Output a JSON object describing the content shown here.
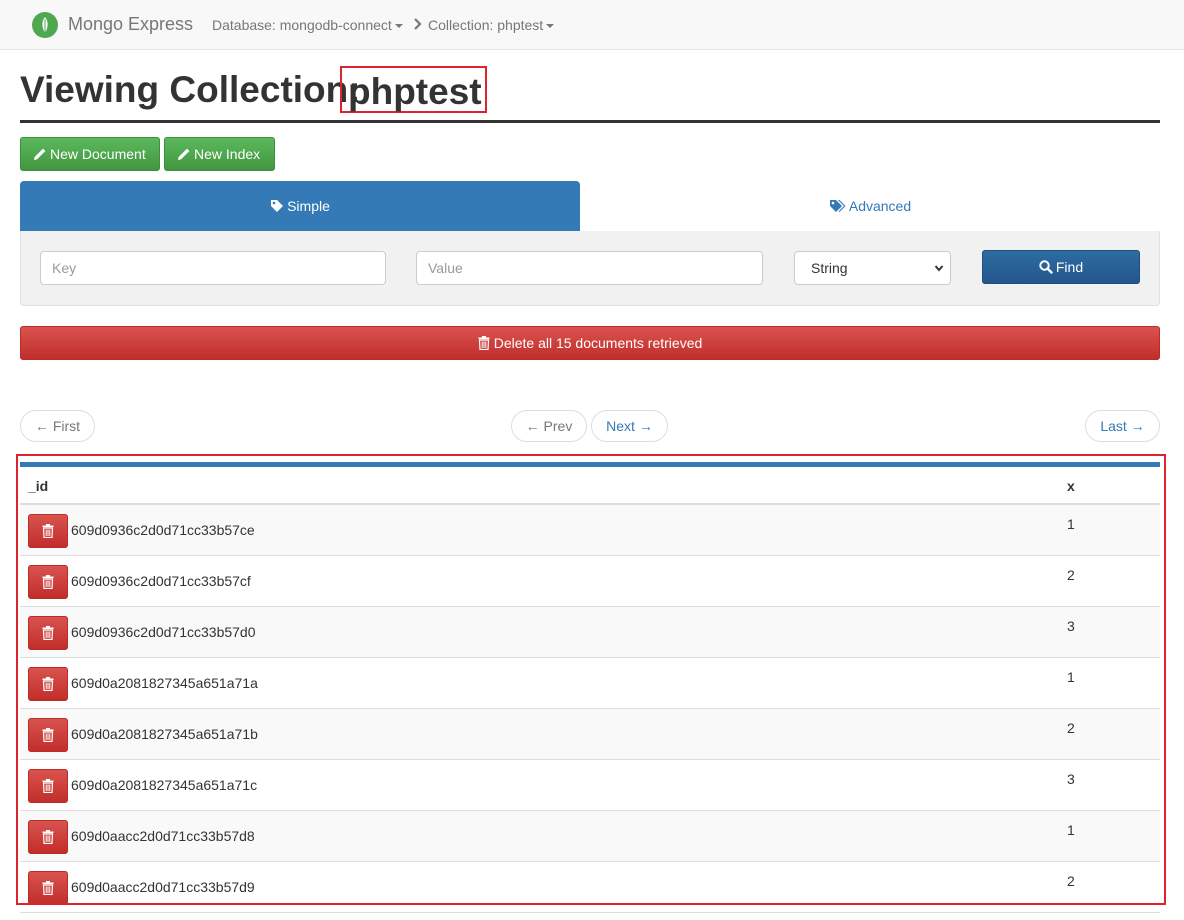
{
  "app": {
    "title": "Mongo Express"
  },
  "breadcrumb": {
    "database": "Database: mongodb-connect",
    "collection": "Collection: phptest"
  },
  "page": {
    "title_prefix": "Viewing Collection:",
    "collection_name": "phptest"
  },
  "toolbar": {
    "new_document": "New Document",
    "new_index": "New Index"
  },
  "search_tabs": {
    "simple": "Simple",
    "advanced": "Advanced",
    "active": "simple"
  },
  "search": {
    "key_placeholder": "Key",
    "value_placeholder": "Value",
    "type_selected": "String",
    "find_label": "Find"
  },
  "delete_all": {
    "label": "Delete all 15 documents retrieved"
  },
  "pagination": {
    "first": "← First",
    "prev": "← Prev",
    "next": "Next →",
    "last": "Last →"
  },
  "table": {
    "columns": [
      "_id",
      "x"
    ],
    "rows": [
      {
        "_id": "609d0936c2d0d71cc33b57ce",
        "x": "1"
      },
      {
        "_id": "609d0936c2d0d71cc33b57cf",
        "x": "2"
      },
      {
        "_id": "609d0936c2d0d71cc33b57d0",
        "x": "3"
      },
      {
        "_id": "609d0a2081827345a651a71a",
        "x": "1"
      },
      {
        "_id": "609d0a2081827345a651a71b",
        "x": "2"
      },
      {
        "_id": "609d0a2081827345a651a71c",
        "x": "3"
      },
      {
        "_id": "609d0aacc2d0d71cc33b57d8",
        "x": "1"
      },
      {
        "_id": "609d0aacc2d0d71cc33b57d9",
        "x": "2"
      }
    ]
  },
  "colors": {
    "primary": "#337ab7",
    "success": "#5cb85c",
    "danger": "#d9534f",
    "annotation": "#d9252b",
    "logo": "#4fa84f"
  },
  "icons": {
    "logo": "mongodb-leaf-icon",
    "new_document": "pencil-icon",
    "new_index": "pencil-icon",
    "simple_tab": "tag-icon",
    "advanced_tab": "tags-icon",
    "find": "search-icon",
    "delete": "trash-icon"
  }
}
